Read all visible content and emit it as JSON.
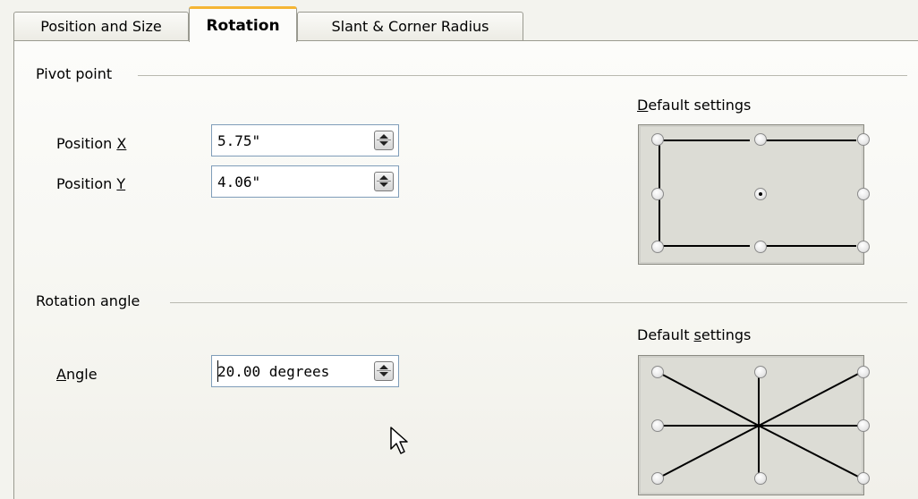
{
  "tabs": [
    {
      "label": "Position and Size",
      "active": false
    },
    {
      "label": "Rotation",
      "active": true
    },
    {
      "label": "Slant & Corner Radius",
      "active": false
    }
  ],
  "pivot": {
    "section_title": "Pivot point",
    "position_x": {
      "label_prefix": "Position ",
      "label_key": "X",
      "value": "5.75\""
    },
    "position_y": {
      "label_prefix": "Position ",
      "label_key": "Y",
      "value": "4.06\""
    },
    "default_settings": {
      "key": "D",
      "rest": "efault settings"
    },
    "selected_point": "center"
  },
  "rotation": {
    "section_title": "Rotation angle",
    "angle": {
      "label_key": "A",
      "label_rest": "ngle",
      "value": "20.00 degrees"
    },
    "default_settings": {
      "prefix": "Default ",
      "key": "s",
      "rest": "ettings"
    }
  },
  "colors": {
    "active_tab_accent": "#f5b534",
    "field_border": "#7f9db9"
  }
}
